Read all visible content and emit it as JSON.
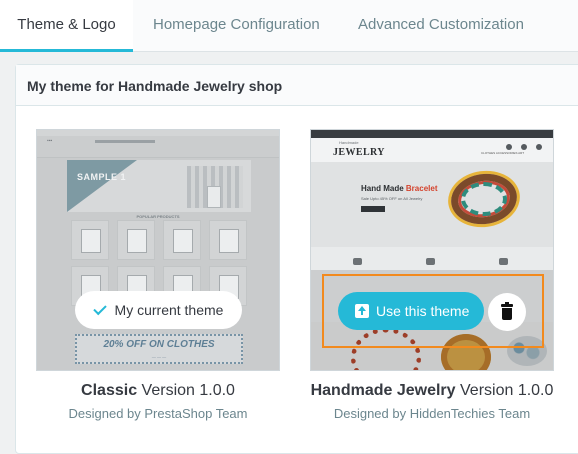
{
  "tabs": [
    {
      "label": "Theme & Logo",
      "active": true
    },
    {
      "label": "Homepage Configuration",
      "active": false
    },
    {
      "label": "Advanced Customization",
      "active": false
    }
  ],
  "panel": {
    "title": "My theme for Handmade Jewelry shop"
  },
  "themes": [
    {
      "name": "Classic",
      "version": "Version 1.0.0",
      "author": "Designed by PrestaShop Team",
      "badge": "My current theme",
      "badge_icon": "check-icon",
      "preview": {
        "hero_title": "SAMPLE 1",
        "section": "POPULAR PRODUCTS",
        "promo": "20% OFF ON CLOTHES"
      }
    },
    {
      "name": "Handmade Jewelry",
      "version": "Version 1.0.0",
      "author": "Designed by HiddenTechies Team",
      "use_label": "Use this theme",
      "use_icon": "upload-icon",
      "delete_icon": "trash-icon",
      "preview": {
        "logo_small": "Handmade",
        "logo_big": "JEWELRY",
        "nav": "CLOTHES   ACCESSORIES   ART",
        "hero_title": "Hand Made",
        "hero_accent": "Bracelet",
        "hero_sub": "Sale Upto 45% OFF on All Jewelry"
      }
    }
  ],
  "colors": {
    "accent": "#25b9d7",
    "highlight": "#f28a1e",
    "text": "#363a41",
    "muted": "#6c868e"
  }
}
